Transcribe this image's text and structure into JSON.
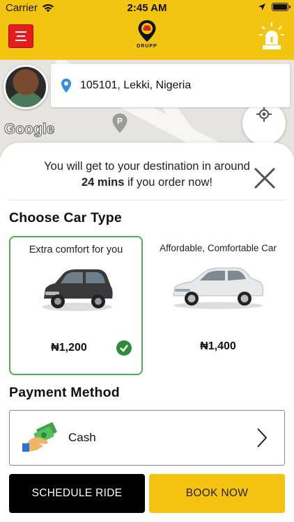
{
  "status_bar": {
    "carrier": "Carrier",
    "time": "2:45 AM",
    "battery_level": 1.0
  },
  "header": {
    "logo_text": "DRUPP",
    "menu_icon": "hamburger-icon",
    "alert_icon": "siren-icon",
    "background_color": "#f2c511",
    "menu_button_color": "#e41c1c"
  },
  "map": {
    "google_label": "Google",
    "location_pin_icon": "map-pin-icon",
    "parking_marker_icon": "parking-pin-icon",
    "locate_icon": "crosshair-icon"
  },
  "location": {
    "address": "105101, Lekki, Nigeria"
  },
  "eta": {
    "line1": "You will get to your destination in around",
    "duration": "24 mins",
    "line2_suffix": " if you order now!"
  },
  "car_section": {
    "title": "Choose Car Type",
    "cars": [
      {
        "caption": "Extra comfort for you",
        "price": "₦1,200",
        "selected": true
      },
      {
        "caption": "Affordable, Comfortable Car",
        "price": "₦1,400",
        "selected": false
      }
    ]
  },
  "payment": {
    "title": "Payment Method",
    "method": "Cash",
    "icon": "cash-icon"
  },
  "actions": {
    "schedule": "SCHEDULE RIDE",
    "book": "BOOK NOW",
    "accent_color": "#f5c30f"
  }
}
